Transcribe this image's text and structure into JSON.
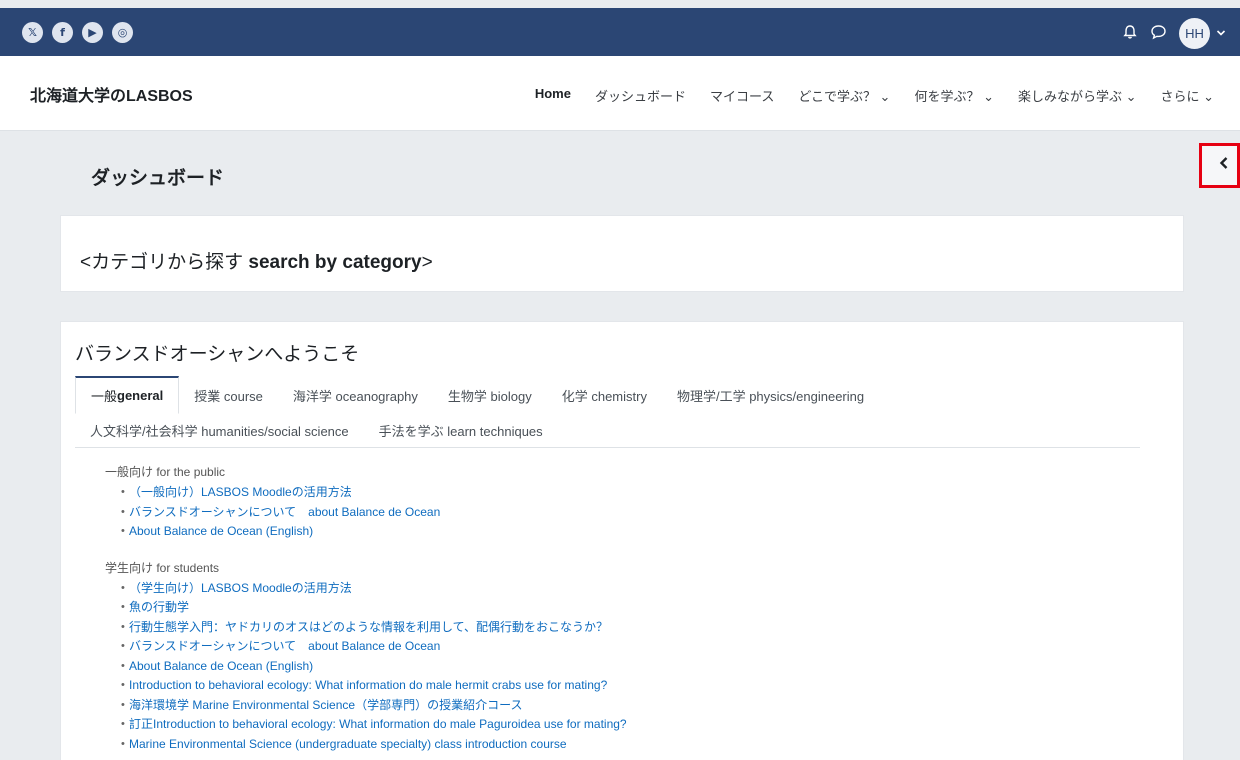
{
  "social": [
    {
      "name": "x-icon",
      "glyph": "𝕏"
    },
    {
      "name": "facebook-icon",
      "glyph": "f"
    },
    {
      "name": "youtube-icon",
      "glyph": "▶"
    },
    {
      "name": "instagram-icon",
      "glyph": "◎"
    }
  ],
  "top_right": {
    "bell_glyph": "🔔",
    "chat_glyph": "💬",
    "avatar_initials": "HH",
    "caret": "⌄"
  },
  "brand": "北海道大学のLASBOS",
  "nav": [
    {
      "label": "Home",
      "active": true
    },
    {
      "label": "ダッシュボード"
    },
    {
      "label": "マイコース"
    },
    {
      "label": "どこで学ぶ？ ⌄"
    },
    {
      "label": "何を学ぶ？ ⌄"
    },
    {
      "label": "楽しみながら学ぶ ⌄"
    },
    {
      "label": "さらに ⌄"
    }
  ],
  "drawer_toggle_glyph": "‹",
  "page_title": "ダッシュボード",
  "category_card": {
    "title_prefix": "<カテゴリから探す ",
    "title_bold": "search by category",
    "title_suffix": ">"
  },
  "welcome_card": {
    "title": "バランスドオーシャンへようこそ",
    "tabs_row1": [
      {
        "label_ja": "一般 ",
        "label_en": "general",
        "active": true
      },
      {
        "label": "授業 course"
      },
      {
        "label": "海洋学 oceanography"
      },
      {
        "label": "生物学 biology"
      },
      {
        "label": "化学 chemistry"
      },
      {
        "label": "物理学/工学 physics/engineering"
      }
    ],
    "tabs_row2": [
      {
        "label": "人文科学/社会科学 humanities/social science"
      },
      {
        "label": "手法を学ぶ learn techniques"
      }
    ],
    "public_heading": "一般向け for the public",
    "public_links": [
      "（一般向け）LASBOS Moodleの活用方法",
      "バランスドオーシャンについて　about Balance de Ocean",
      "About Balance de Ocean (English)"
    ],
    "students_heading": "学生向け for students",
    "student_links": [
      "（学生向け）LASBOS Moodleの活用方法",
      "魚の行動学",
      "行動生態学入門：ヤドカリのオスはどのような情報を利用して、配偶行動をおこなうか？",
      "バランスドオーシャンについて　about Balance de Ocean",
      "About Balance de Ocean (English)",
      "Introduction to behavioral ecology: What information do male hermit crabs use for mating?",
      "海洋環境学 Marine Environmental Science（学部専門）の授業紹介コース",
      "訂正Introduction to behavioral ecology: What information do male Paguroidea use for mating?",
      "Marine Environmental Science (undergraduate specialty) class introduction course"
    ]
  },
  "colors": {
    "topbar": "#2b4674",
    "link": "#0f6cbf",
    "highlight": "#e60012"
  }
}
